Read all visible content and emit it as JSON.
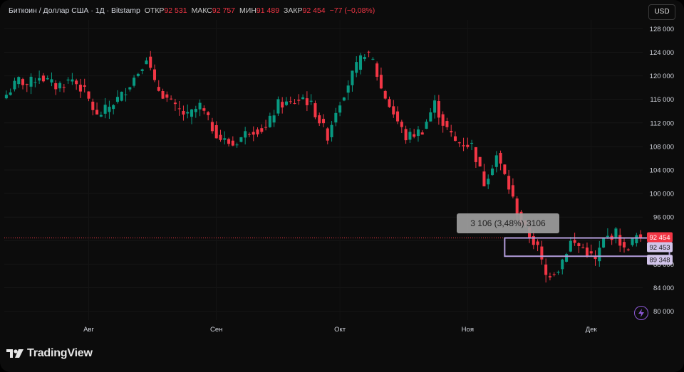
{
  "header": {
    "symbol": "Биткоин / Доллар США · 1Д · Bitstamp",
    "open_label": "ОТКР",
    "open_value": "92 531",
    "high_label": "МАКС",
    "high_value": "92 757",
    "low_label": "МИН",
    "low_value": "91 489",
    "close_label": "ЗАКР",
    "close_value": "92 454",
    "change_value": "−77 (−0,08%)"
  },
  "currency_button": "USD",
  "logo_text": "TradingView",
  "icons": {
    "logo": "tradingview-logo-icon",
    "flash": "lightning-icon"
  },
  "colors": {
    "up": "#089981",
    "down": "#f23645",
    "background": "#0c0c0c",
    "measure_box": "#b39ddb",
    "label_current": "#f23645"
  },
  "chart_data": {
    "type": "candlestick",
    "y_scale": "linear",
    "ylim": [
      78500,
      129500
    ],
    "y_ticks": [
      80000,
      84000,
      88000,
      92000,
      96000,
      100000,
      104000,
      108000,
      112000,
      116000,
      120000,
      124000,
      128000
    ],
    "y_tick_labels": [
      "80 000",
      "84 000",
      "88 000",
      "",
      "96 000",
      "100 000",
      "104 000",
      "108 000",
      "112 000",
      "116 000",
      "120 000",
      "124 000",
      "128 000"
    ],
    "x_labels": [
      {
        "label": "Авг",
        "index": 20
      },
      {
        "label": "Сен",
        "index": 51
      },
      {
        "label": "Окт",
        "index": 81
      },
      {
        "label": "Ноя",
        "index": 112
      },
      {
        "label": "Дек",
        "index": 142
      }
    ],
    "last_price": 92454,
    "price_labels": [
      {
        "text": "92 454",
        "kind": "current"
      },
      {
        "text": "92 453",
        "kind": "range-top"
      },
      {
        "text": "89 348",
        "kind": "range-bottom"
      }
    ],
    "measure": {
      "text": "3 106 (3,48%) 3106",
      "top": 92453,
      "bottom": 89348,
      "start_index": 121,
      "end_index": 153
    },
    "close_path": [
      [
        0,
        116800
      ],
      [
        3,
        119300
      ],
      [
        5,
        118500
      ],
      [
        8,
        120000
      ],
      [
        12,
        118200
      ],
      [
        16,
        119400
      ],
      [
        19,
        117300
      ],
      [
        22,
        113000
      ],
      [
        25,
        114800
      ],
      [
        28,
        116700
      ],
      [
        32,
        120700
      ],
      [
        34,
        123300
      ],
      [
        36,
        118500
      ],
      [
        41,
        114500
      ],
      [
        44,
        113100
      ],
      [
        47,
        114900
      ],
      [
        50,
        111200
      ],
      [
        52,
        109300
      ],
      [
        55,
        108300
      ],
      [
        59,
        110800
      ],
      [
        63,
        111000
      ],
      [
        66,
        115200
      ],
      [
        69,
        115300
      ],
      [
        72,
        116300
      ],
      [
        74,
        115000
      ],
      [
        78,
        109800
      ],
      [
        80,
        114200
      ],
      [
        84,
        120200
      ],
      [
        87,
        124000
      ],
      [
        89,
        122500
      ],
      [
        91,
        117800
      ],
      [
        94,
        113600
      ],
      [
        97,
        109500
      ],
      [
        101,
        110800
      ],
      [
        104,
        115300
      ],
      [
        106,
        112000
      ],
      [
        109,
        108800
      ],
      [
        113,
        108200
      ],
      [
        116,
        101800
      ],
      [
        119,
        106500
      ],
      [
        121,
        103000
      ],
      [
        125,
        95000
      ],
      [
        127,
        92900
      ],
      [
        129,
        90700
      ],
      [
        131,
        86000
      ],
      [
        134,
        87300
      ],
      [
        137,
        91800
      ],
      [
        140,
        90700
      ],
      [
        143,
        88600
      ],
      [
        145,
        92200
      ],
      [
        148,
        93300
      ],
      [
        150,
        90300
      ],
      [
        153,
        92700
      ],
      [
        154,
        92454
      ]
    ],
    "noise": [
      [],
      [],
      []
    ]
  }
}
